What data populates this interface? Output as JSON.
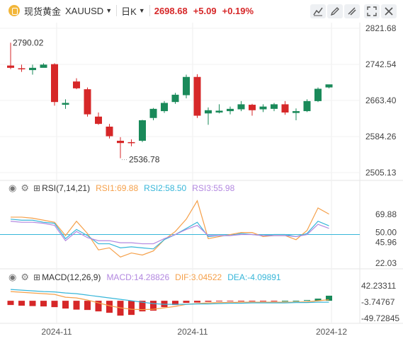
{
  "header": {
    "instrument_name": "现货黄金",
    "symbol": "XAUUSD",
    "period": "日K",
    "price": "2698.68",
    "change": "+5.09",
    "change_pct": "+0.19%",
    "up_color": "#d62728",
    "down_color": "#1a8a5a"
  },
  "toolbar": {
    "icons": [
      "indicator-chart-icon",
      "draw-pencil-icon",
      "drawing-tool-icon",
      "fullscreen-icon",
      "close-icon"
    ]
  },
  "chart_data": [
    {
      "type": "candlestick",
      "title": "现货黄金 XAUUSD 日K",
      "y_ticks": [
        "2821.68",
        "2742.54",
        "2663.40",
        "2584.26",
        "2505.13"
      ],
      "ylim": [
        2505.13,
        2821.68
      ],
      "x_ticks": [
        "2024-11",
        "2024-11",
        "2024-12"
      ],
      "high_label": "2790.02",
      "low_label": "2536.78",
      "candles": [
        {
          "o": 2740,
          "h": 2790.02,
          "l": 2732,
          "c": 2735
        },
        {
          "o": 2734,
          "h": 2742,
          "l": 2726,
          "c": 2732
        },
        {
          "o": 2730,
          "h": 2742,
          "l": 2720,
          "c": 2735
        },
        {
          "o": 2735,
          "h": 2745,
          "l": 2738,
          "c": 2742
        },
        {
          "o": 2743,
          "h": 2745,
          "l": 2652,
          "c": 2660
        },
        {
          "o": 2654,
          "h": 2666,
          "l": 2645,
          "c": 2658
        },
        {
          "o": 2705,
          "h": 2712,
          "l": 2688,
          "c": 2690
        },
        {
          "o": 2688,
          "h": 2692,
          "l": 2628,
          "c": 2633
        },
        {
          "o": 2628,
          "h": 2637,
          "l": 2610,
          "c": 2612
        },
        {
          "o": 2606,
          "h": 2612,
          "l": 2580,
          "c": 2585
        },
        {
          "o": 2575,
          "h": 2583,
          "l": 2536.78,
          "c": 2570
        },
        {
          "o": 2572,
          "h": 2578,
          "l": 2563,
          "c": 2570
        },
        {
          "o": 2575,
          "h": 2621,
          "l": 2572,
          "c": 2620
        },
        {
          "o": 2625,
          "h": 2647,
          "l": 2620,
          "c": 2645
        },
        {
          "o": 2640,
          "h": 2662,
          "l": 2636,
          "c": 2658
        },
        {
          "o": 2660,
          "h": 2680,
          "l": 2656,
          "c": 2676
        },
        {
          "o": 2675,
          "h": 2720,
          "l": 2668,
          "c": 2715
        },
        {
          "o": 2715,
          "h": 2721,
          "l": 2625,
          "c": 2630
        },
        {
          "o": 2635,
          "h": 2648,
          "l": 2610,
          "c": 2642
        },
        {
          "o": 2637,
          "h": 2655,
          "l": 2635,
          "c": 2641
        },
        {
          "o": 2640,
          "h": 2650,
          "l": 2633,
          "c": 2645
        },
        {
          "o": 2644,
          "h": 2662,
          "l": 2640,
          "c": 2655
        },
        {
          "o": 2654,
          "h": 2656,
          "l": 2630,
          "c": 2642
        },
        {
          "o": 2644,
          "h": 2655,
          "l": 2638,
          "c": 2650
        },
        {
          "o": 2645,
          "h": 2658,
          "l": 2640,
          "c": 2655
        },
        {
          "o": 2655,
          "h": 2662,
          "l": 2632,
          "c": 2637
        },
        {
          "o": 2636,
          "h": 2646,
          "l": 2620,
          "c": 2640
        },
        {
          "o": 2640,
          "h": 2666,
          "l": 2638,
          "c": 2662
        },
        {
          "o": 2662,
          "h": 2692,
          "l": 2660,
          "c": 2689
        },
        {
          "o": 2692,
          "h": 2698,
          "l": 2690,
          "c": 2698.68
        }
      ]
    },
    {
      "type": "line",
      "title": "RSI(7,14,21)",
      "ylim": [
        22.03,
        87
      ],
      "y_ticks": [
        "69.88",
        "50.00",
        "45.96",
        "22.03"
      ],
      "series": [
        {
          "name": "RSI1",
          "label": "RSI1:69.88",
          "color": "#f5a04a",
          "values": [
            67,
            67,
            66,
            64,
            62,
            49,
            63,
            51,
            35,
            37,
            28,
            32,
            30,
            34,
            45,
            53,
            65,
            83,
            46,
            48,
            50,
            52,
            52,
            48,
            49,
            49,
            45,
            54,
            76,
            70
          ]
        },
        {
          "name": "RSI2",
          "label": "RSI2:58.50",
          "color": "#37b6d9",
          "values": [
            65,
            64,
            64,
            62,
            61,
            46,
            55,
            49,
            41,
            41,
            37,
            38,
            37,
            36,
            45,
            50,
            56,
            62,
            48,
            49,
            49,
            51,
            50,
            49,
            50,
            50,
            48,
            51,
            63,
            58.5
          ]
        },
        {
          "name": "RSI3",
          "label": "RSI3:55.98",
          "color": "#b388e0",
          "values": [
            63,
            62,
            62,
            61,
            59,
            44,
            53,
            47,
            44,
            44,
            42,
            42,
            41,
            41,
            46,
            50,
            55,
            59,
            49,
            49,
            49,
            50,
            50,
            49,
            49,
            49,
            48,
            50,
            60,
            56
          ]
        }
      ]
    },
    {
      "type": "bar+line",
      "title": "MACD(12,26,9)",
      "ylim": [
        -49.73,
        42.23
      ],
      "y_ticks": [
        "42.23311",
        "-3.74767",
        "-49.72845"
      ],
      "labels": {
        "macd": "MACD:14.28826",
        "dif": "DIF:3.04522",
        "dea": "DEA:-4.09891"
      },
      "dif_color": "#f5a04a",
      "dea_color": "#37b6d9",
      "macd": [
        -12,
        -14,
        -15,
        -16,
        -18,
        -22,
        -25,
        -26,
        -30,
        -34,
        -42,
        -40,
        -30,
        -28,
        -18,
        -12,
        -6,
        -5,
        -3,
        -2,
        -2,
        -1,
        -1,
        -1,
        -1,
        0,
        0,
        2,
        6,
        14.29
      ],
      "dif": [
        26,
        24,
        22,
        20,
        18,
        10,
        8,
        2,
        -6,
        -14,
        -20,
        -24,
        -25,
        -24,
        -20,
        -16,
        -10,
        -8,
        -6,
        -5,
        -5,
        -4,
        -4,
        -4,
        -4,
        -4,
        -4,
        -3,
        0,
        3.05
      ],
      "dea": [
        32,
        30,
        28,
        26,
        25,
        22,
        20,
        16,
        12,
        8,
        4,
        0,
        -4,
        -8,
        -10,
        -10,
        -10,
        -9,
        -9,
        -8,
        -7,
        -7,
        -6,
        -6,
        -6,
        -6,
        -5,
        -5,
        -4,
        -4.1
      ]
    }
  ],
  "panels": {
    "rsi_label": "RSI(7,14,21)",
    "rsi1_label": "RSI1:69.88",
    "rsi2_label": "RSI2:58.50",
    "rsi3_label": "RSI3:55.98",
    "macd_label": "MACD(12,26,9)",
    "macd_value_label": "MACD:14.28826",
    "dif_label": "DIF:3.04522",
    "dea_label": "DEA:-4.09891"
  }
}
